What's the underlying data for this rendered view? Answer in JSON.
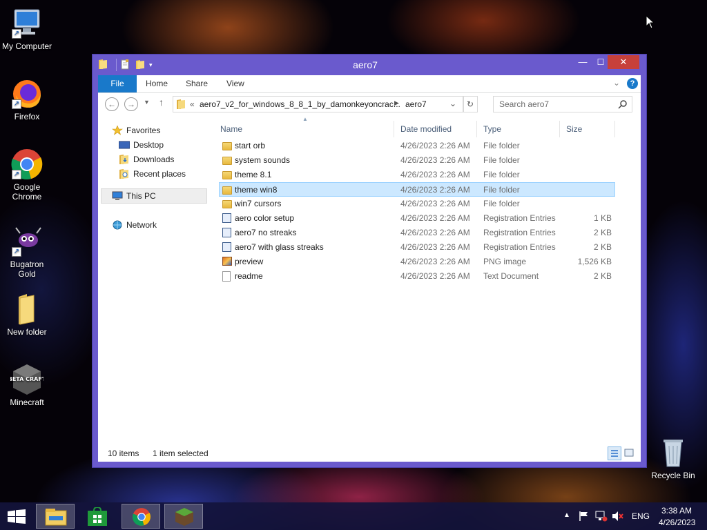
{
  "desktop": {
    "icons": [
      {
        "label": "My Computer"
      },
      {
        "label": "Firefox"
      },
      {
        "label": "Google Chrome"
      },
      {
        "label": "Bugatron Gold"
      },
      {
        "label": "New folder"
      },
      {
        "label": "Minecraft"
      },
      {
        "label": "Recycle Bin"
      }
    ],
    "minecraft_art_text": "BETA CRAFT"
  },
  "window": {
    "title": "aero7",
    "controls": {
      "minimize": "—",
      "maximize": "☐",
      "close": "✕"
    },
    "ribbon": {
      "tabs": [
        "File",
        "Home",
        "Share",
        "View"
      ]
    },
    "address": {
      "prefix": "«",
      "segments": [
        "aero7_v2_for_windows_8_8_1_by_damonkeyoncrac...",
        "aero7"
      ]
    },
    "search": {
      "placeholder": "Search aero7"
    },
    "nav_pane": {
      "favorites": "Favorites",
      "items": [
        "Desktop",
        "Downloads",
        "Recent places"
      ],
      "this_pc": "This PC",
      "network": "Network"
    },
    "columns": [
      "Name",
      "Date modified",
      "Type",
      "Size"
    ],
    "files": [
      {
        "name": "start orb",
        "date": "4/26/2023 2:26 AM",
        "type": "File folder",
        "size": "",
        "icon": "folder-icon"
      },
      {
        "name": "system sounds",
        "date": "4/26/2023 2:26 AM",
        "type": "File folder",
        "size": "",
        "icon": "folder-icon"
      },
      {
        "name": "theme 8.1",
        "date": "4/26/2023 2:26 AM",
        "type": "File folder",
        "size": "",
        "icon": "folder-icon"
      },
      {
        "name": "theme win8",
        "date": "4/26/2023 2:26 AM",
        "type": "File folder",
        "size": "",
        "icon": "folder-icon",
        "selected": true
      },
      {
        "name": "win7 cursors",
        "date": "4/26/2023 2:26 AM",
        "type": "File folder",
        "size": "",
        "icon": "folder-icon"
      },
      {
        "name": "aero color setup",
        "date": "4/26/2023 2:26 AM",
        "type": "Registration Entries",
        "size": "1 KB",
        "icon": "registry-file-icon"
      },
      {
        "name": "aero7 no streaks",
        "date": "4/26/2023 2:26 AM",
        "type": "Registration Entries",
        "size": "2 KB",
        "icon": "registry-file-icon"
      },
      {
        "name": "aero7 with glass streaks",
        "date": "4/26/2023 2:26 AM",
        "type": "Registration Entries",
        "size": "2 KB",
        "icon": "registry-file-icon"
      },
      {
        "name": "preview",
        "date": "4/26/2023 2:26 AM",
        "type": "PNG image",
        "size": "1,526 KB",
        "icon": "image-file-icon"
      },
      {
        "name": "readme",
        "date": "4/26/2023 2:26 AM",
        "type": "Text Document",
        "size": "2 KB",
        "icon": "text-file-icon"
      }
    ],
    "status": {
      "count": "10 items",
      "selection": "1 item selected"
    }
  },
  "taskbar": {
    "language": "ENG",
    "time": "3:38 AM",
    "date": "4/26/2023"
  },
  "colors": {
    "window_frame": "#6a5acd",
    "close_button": "#c7403a",
    "file_tab": "#1979ca",
    "selection": "#cce8ff"
  }
}
